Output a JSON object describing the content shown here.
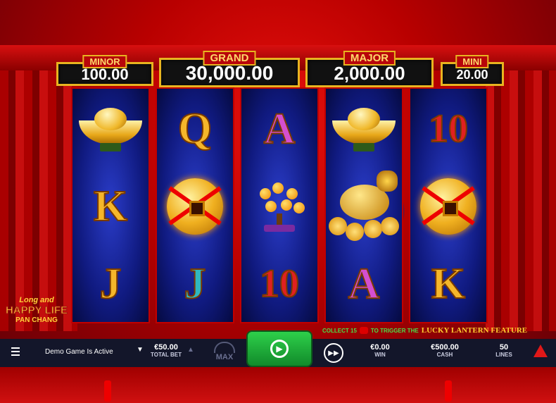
{
  "jackpots": {
    "minor": {
      "label": "MINOR",
      "value": "100.00"
    },
    "grand": {
      "label": "GRAND",
      "value": "30,000.00"
    },
    "major": {
      "label": "MAJOR",
      "value": "2,000.00"
    },
    "mini": {
      "label": "MINI",
      "value": "20.00"
    }
  },
  "reels": [
    [
      "gold-ingot",
      "K",
      "J"
    ],
    [
      "Q",
      "gold-coin",
      "J"
    ],
    [
      "A",
      "orange-tree",
      "10"
    ],
    [
      "gold-ingot",
      "golden-dragon-turtle",
      "A"
    ],
    [
      "10",
      "gold-coin",
      "K"
    ]
  ],
  "logo": {
    "line1": "Long and",
    "line2": "HAPPY LIFE",
    "line3": "PAN CHANG"
  },
  "feature_banner": {
    "collect": "COLLECT 15",
    "trigger": "TO TRIGGER THE",
    "feature": "LUCKY LANTERN FEATURE"
  },
  "bottom_bar": {
    "demo_text": "Demo Game Is Active",
    "total_bet_value": "€50.00",
    "total_bet_label": "TOTAL BET",
    "max_label": "MAX",
    "win_value": "€0.00",
    "win_label": "WIN",
    "cash_value": "€500.00",
    "cash_label": "CASH",
    "lines_value": "50",
    "lines_label": "LINES"
  }
}
